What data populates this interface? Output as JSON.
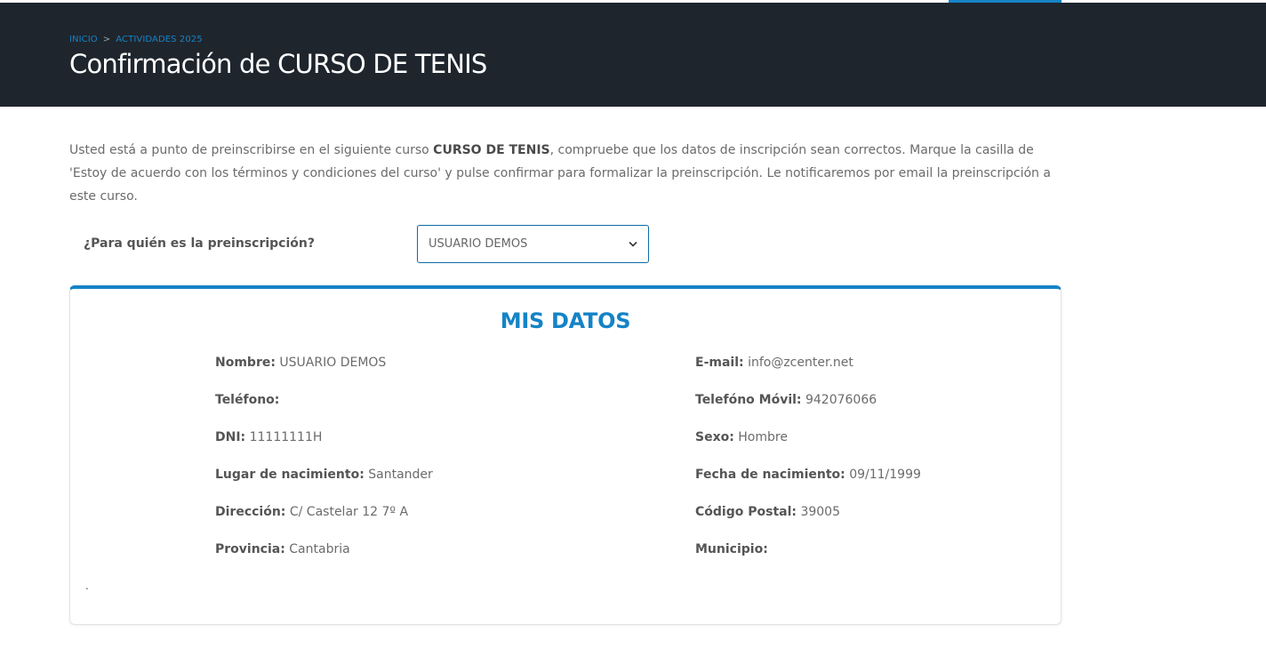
{
  "colors": {
    "accent": "#1583c6",
    "accent_dark": "#0f6aa3",
    "header_bg": "#1f252d"
  },
  "breadcrumb": {
    "home": "INICIO",
    "separator": ">",
    "current": "ACTIVIDADES 2025"
  },
  "page_title": "Confirmación de CURSO DE TENIS",
  "intro": {
    "before": "Usted está a punto de preinscribirse en el siguiente curso ",
    "course": "CURSO DE TENIS",
    "after": ", compruebe que los datos de inscripción sean correctos. Marque la casilla de 'Estoy de acuerdo con los términos y condiciones del curso' y pulse confirmar para formalizar la preinscripción. Le notificaremos por email la preinscripción a este curso."
  },
  "who": {
    "label": "¿Para quién es la preinscripción?",
    "selected": "USUARIO DEMOS",
    "chevron_icon": "chevron-down-icon"
  },
  "card": {
    "title": "MIS DATOS",
    "footer_mark": ".",
    "fields": {
      "nombre": {
        "label": "Nombre:",
        "value": "USUARIO DEMOS"
      },
      "email": {
        "label": "E-mail:",
        "value": "info@zcenter.net"
      },
      "telefono": {
        "label": "Teléfono:",
        "value": ""
      },
      "movil": {
        "label": "Telefóno Móvil:",
        "value": "942076066"
      },
      "dni": {
        "label": "DNI:",
        "value": "11111111H"
      },
      "sexo": {
        "label": "Sexo:",
        "value": "Hombre"
      },
      "lugar": {
        "label": "Lugar de nacimiento:",
        "value": "Santander"
      },
      "fecha": {
        "label": "Fecha de nacimiento:",
        "value": "09/11/1999"
      },
      "direccion": {
        "label": "Dirección:",
        "value": "C/ Castelar 12 7º A"
      },
      "cp": {
        "label": "Código Postal:",
        "value": "39005"
      },
      "provincia": {
        "label": "Provincia:",
        "value": "Cantabria"
      },
      "municipio": {
        "label": "Municipio:",
        "value": ""
      }
    }
  }
}
